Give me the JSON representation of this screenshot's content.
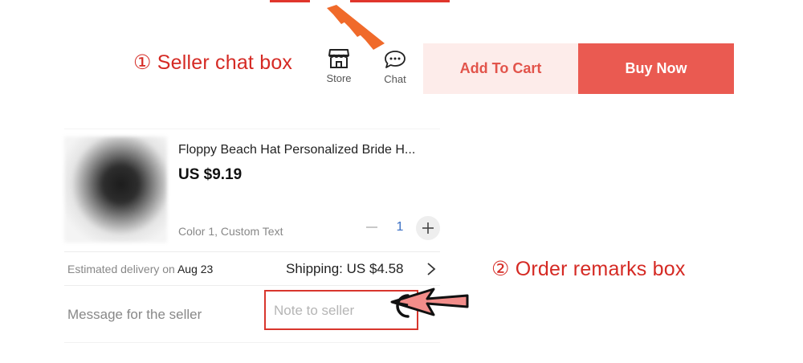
{
  "annotations": {
    "seller_chat": "① Seller chat box",
    "order_remarks": "② Order remarks box"
  },
  "actions": {
    "store_label": "Store",
    "chat_label": "Chat",
    "add_to_cart": "Add To Cart",
    "buy_now": "Buy Now"
  },
  "product": {
    "title": "Floppy Beach Hat Personalized Bride H...",
    "price": "US $9.19",
    "variant": "Color 1, Custom Text",
    "quantity": "1"
  },
  "delivery": {
    "prefix": "Estimated delivery on",
    "date": "Aug 23",
    "shipping": "Shipping: US $4.58"
  },
  "message": {
    "label": "Message for the seller",
    "placeholder": "Note to seller"
  },
  "colors": {
    "accent_red": "#ea5a51",
    "annotation_red": "#d52a24",
    "cart_bg": "#fdecea",
    "arrow_orange": "#f06a2a"
  },
  "icons": [
    "store-icon",
    "chat-icon",
    "minus-icon",
    "plus-icon",
    "chevron-right-icon",
    "arrow-pointer-icon",
    "chevron-arrows-icon"
  ]
}
